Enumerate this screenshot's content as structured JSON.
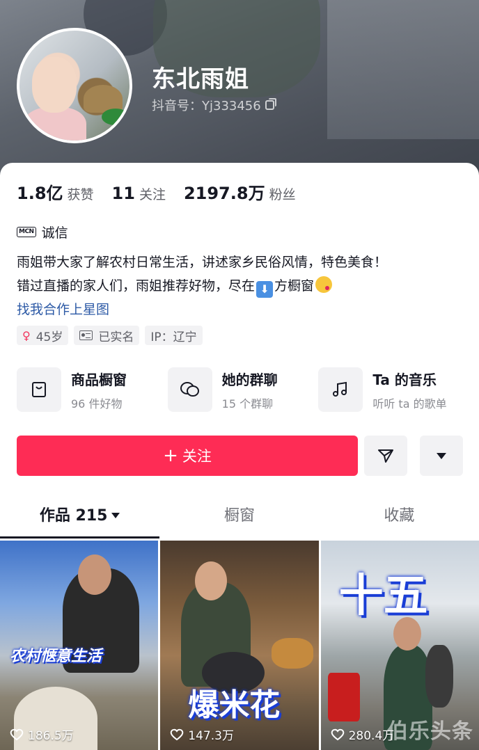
{
  "profile": {
    "name": "东北雨姐",
    "douyin_id": "抖音号：Yj333456"
  },
  "stats": [
    {
      "num": "1.8亿",
      "label": "获赞"
    },
    {
      "num": "11",
      "label": "关注"
    },
    {
      "num": "2197.8万",
      "label": "粉丝"
    }
  ],
  "mcn": {
    "icon_text": "MCN",
    "label": "诚信"
  },
  "bio": {
    "line1": "雨姐带大家了解农村日常生活，讲述家乡民俗风情，特色美食！",
    "line2_before": "错过直播的家人们，雨姐推荐好物，尽在",
    "line2_after": "方橱窗",
    "link": "找我合作上星图"
  },
  "tags": {
    "age": "45岁",
    "verified": "已实名",
    "ip": "IP：辽宁"
  },
  "features": [
    {
      "title": "商品橱窗",
      "sub": "96 件好物",
      "icon": "shopping-bag-icon"
    },
    {
      "title": "她的群聊",
      "sub": "15 个群聊",
      "icon": "chat-bubbles-icon"
    },
    {
      "title": "Ta 的音乐",
      "sub": "听听 ta 的歌单",
      "icon": "music-note-icon"
    }
  ],
  "actions": {
    "follow_plus": "+",
    "follow_label": "关注"
  },
  "tabs": [
    {
      "label": "作品 215",
      "active": true
    },
    {
      "label": "橱窗",
      "active": false
    },
    {
      "label": "收藏",
      "active": false
    }
  ],
  "videos": [
    {
      "overlay": "农村惬意生活",
      "likes": "186.5万"
    },
    {
      "overlay": "爆米花",
      "likes": "147.3万"
    },
    {
      "overlay": "十五",
      "likes": "280.4万"
    }
  ],
  "watermark": "伯乐头条"
}
